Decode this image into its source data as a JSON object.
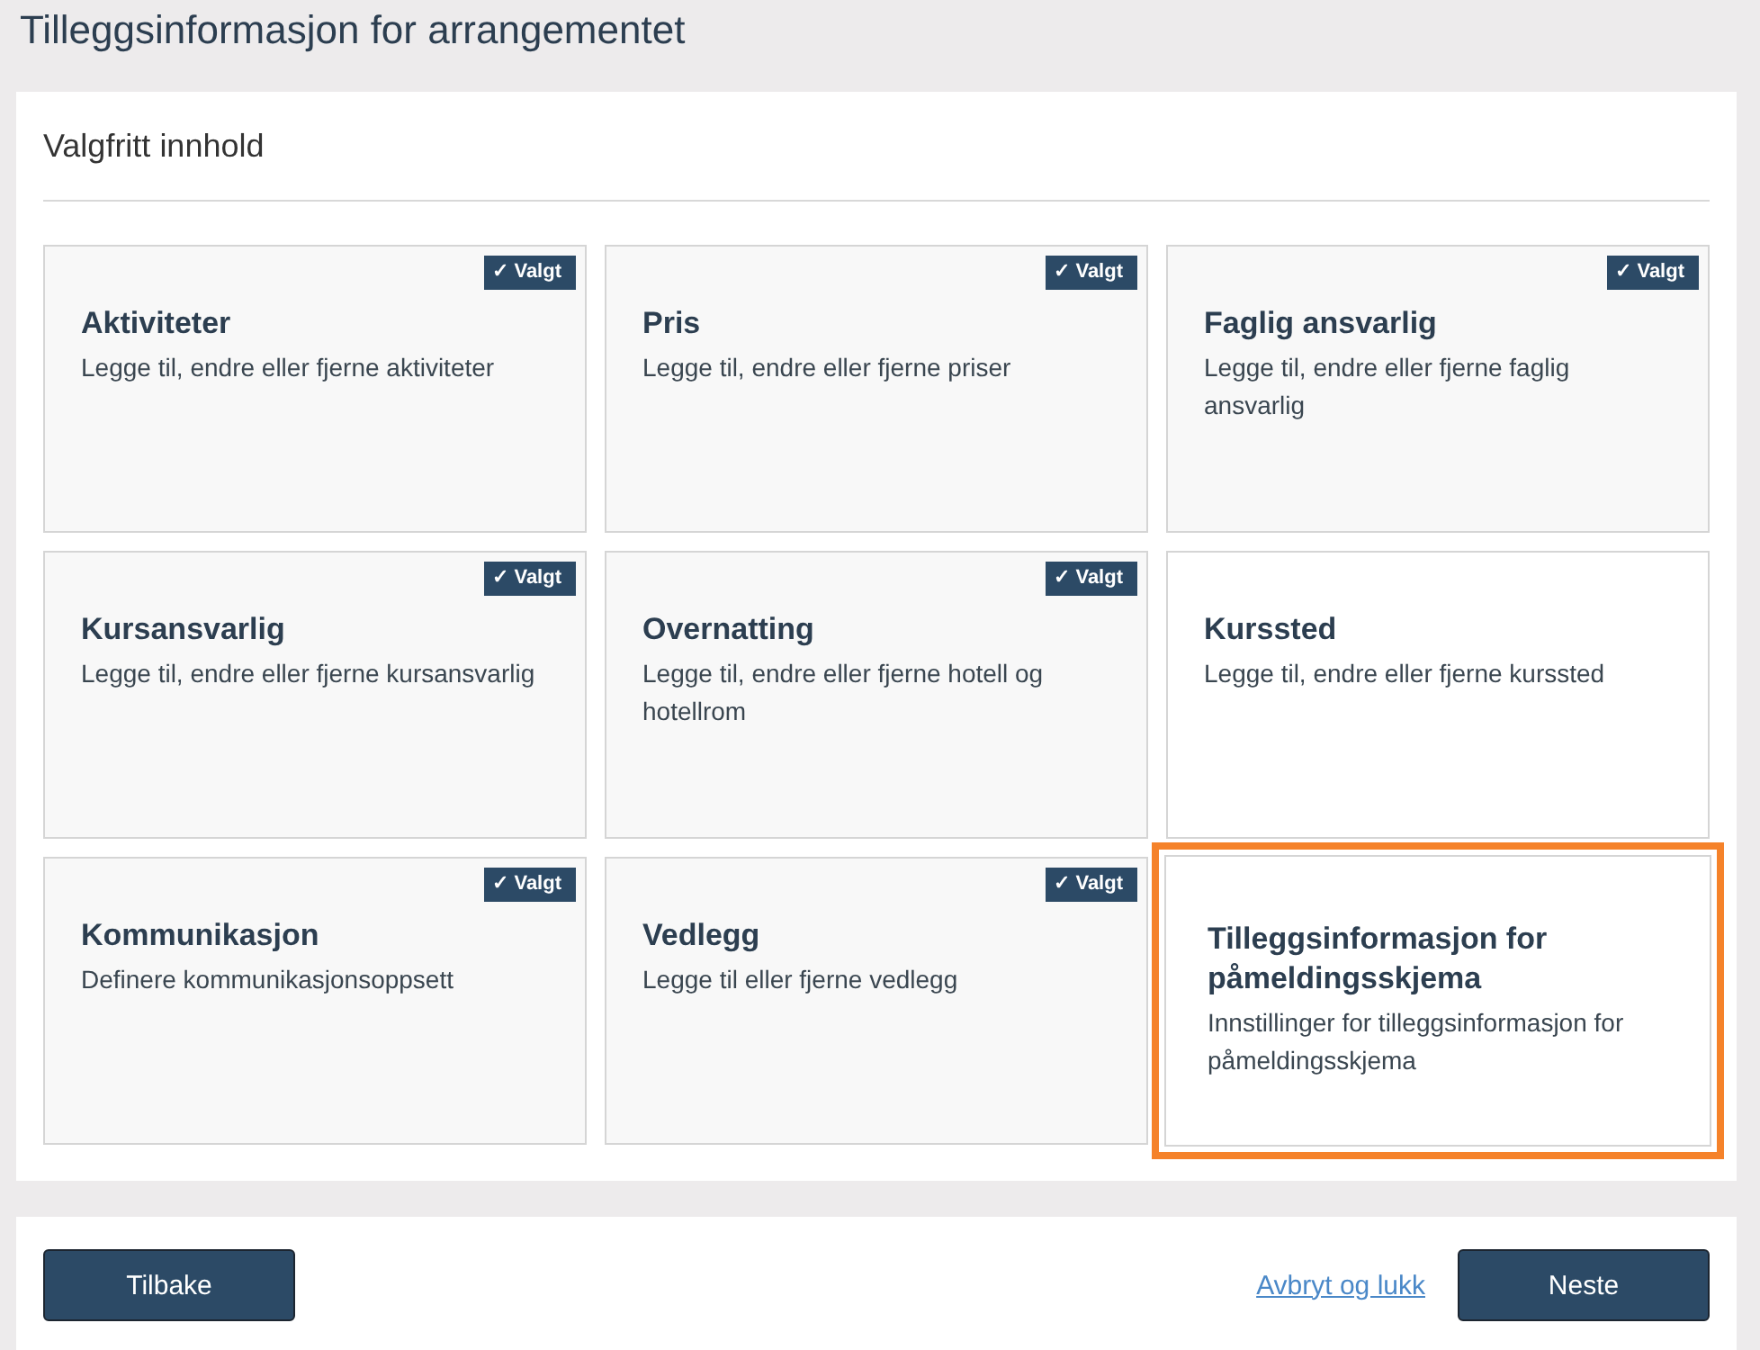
{
  "page_title": "Tilleggsinformasjon for arrangementet",
  "section": {
    "heading": "Valgfritt innhold",
    "cards": [
      {
        "title": "Aktiviteter",
        "description": "Legge til, endre eller fjerne aktiviteter",
        "selected": true,
        "badge": "✓ Valgt",
        "focused": false
      },
      {
        "title": "Pris",
        "description": "Legge til, endre eller fjerne priser",
        "selected": true,
        "badge": "✓ Valgt",
        "focused": false
      },
      {
        "title": "Faglig ansvarlig",
        "description": "Legge til, endre eller fjerne faglig ansvarlig",
        "selected": true,
        "badge": "✓ Valgt",
        "focused": false
      },
      {
        "title": "Kursansvarlig",
        "description": "Legge til, endre eller fjerne kursansvarlig",
        "selected": true,
        "badge": "✓ Valgt",
        "focused": false
      },
      {
        "title": "Overnatting",
        "description": "Legge til, endre eller fjerne hotell og hotellrom",
        "selected": true,
        "badge": "✓ Valgt",
        "focused": false
      },
      {
        "title": "Kurssted",
        "description": "Legge til, endre eller fjerne kurssted",
        "selected": false,
        "focused": false
      },
      {
        "title": "Kommunikasjon",
        "description": "Definere kommunikasjonsoppsett",
        "selected": true,
        "badge": "✓ Valgt",
        "focused": false
      },
      {
        "title": "Vedlegg",
        "description": "Legge til eller fjerne vedlegg",
        "selected": true,
        "badge": "✓ Valgt",
        "focused": false
      },
      {
        "title": "Tilleggsinformasjon for påmeldingsskjema",
        "description": "Innstillinger for tilleggsinformasjon for påmeldingsskjema",
        "selected": false,
        "focused": true
      }
    ]
  },
  "footer": {
    "back_button": "Tilbake",
    "cancel_link": "Avbryt og lukk",
    "next_button": "Neste"
  }
}
